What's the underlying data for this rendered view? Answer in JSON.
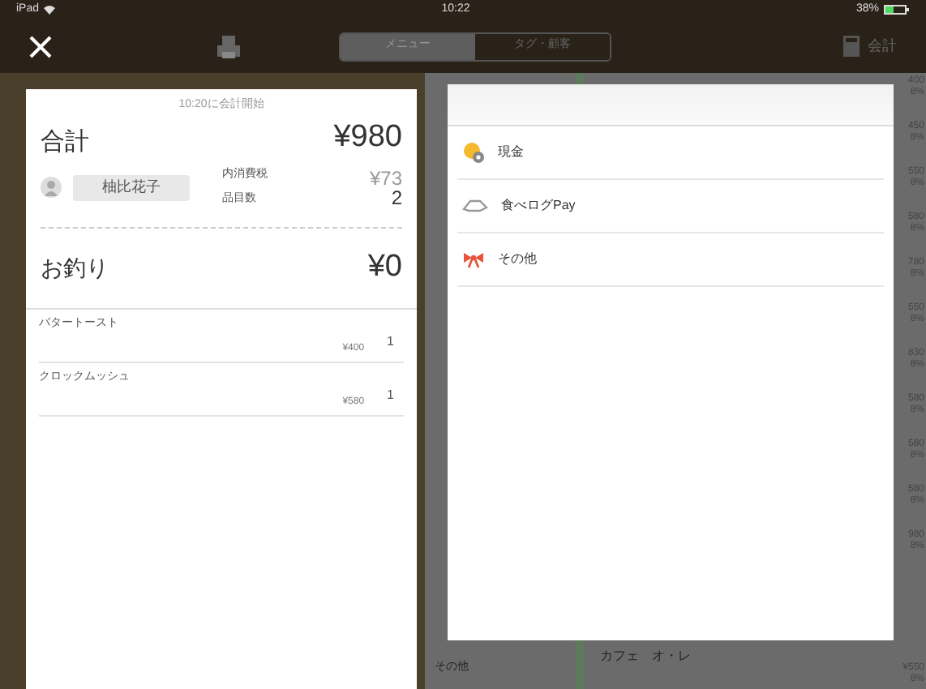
{
  "status_bar": {
    "device": "iPad",
    "time": "10:22",
    "battery": "38%"
  },
  "nav": {
    "tabs": [
      {
        "label": "メニュー",
        "selected": true
      },
      {
        "label": "タグ・顧客",
        "selected": false
      }
    ],
    "checkout": "会計"
  },
  "receipt": {
    "started": "10:20に会計開始",
    "total_label": "合計",
    "total": "¥980",
    "customer": "柚比花子",
    "tax_label": "内消費税",
    "tax": "¥73",
    "count_label": "品目数",
    "count": "2",
    "change_label": "お釣り",
    "change": "¥0",
    "items": [
      {
        "name": "バタートースト",
        "price": "¥400",
        "qty": "1"
      },
      {
        "name": "クロックムッシュ",
        "price": "¥580",
        "qty": "1"
      }
    ]
  },
  "payment_methods": [
    {
      "kind": "cash",
      "label": "現金"
    },
    {
      "kind": "tabelog",
      "label": "食べログPay"
    },
    {
      "kind": "other",
      "label": "その他"
    }
  ],
  "menu_prices": [
    {
      "price": "400",
      "tax": "8%"
    },
    {
      "price": "450",
      "tax": "8%"
    },
    {
      "price": "550",
      "tax": "8%"
    },
    {
      "price": "580",
      "tax": "8%"
    },
    {
      "price": "780",
      "tax": "8%"
    },
    {
      "price": "550",
      "tax": "8%"
    },
    {
      "price": "830",
      "tax": "8%"
    },
    {
      "price": "580",
      "tax": "8%"
    },
    {
      "price": "580",
      "tax": "8%"
    },
    {
      "price": "580",
      "tax": "8%"
    },
    {
      "price": "980",
      "tax": "8%"
    }
  ],
  "menu_bottom": {
    "category": "その他",
    "item": "カフェ　オ・レ",
    "price": "¥550",
    "tax": "8%"
  }
}
